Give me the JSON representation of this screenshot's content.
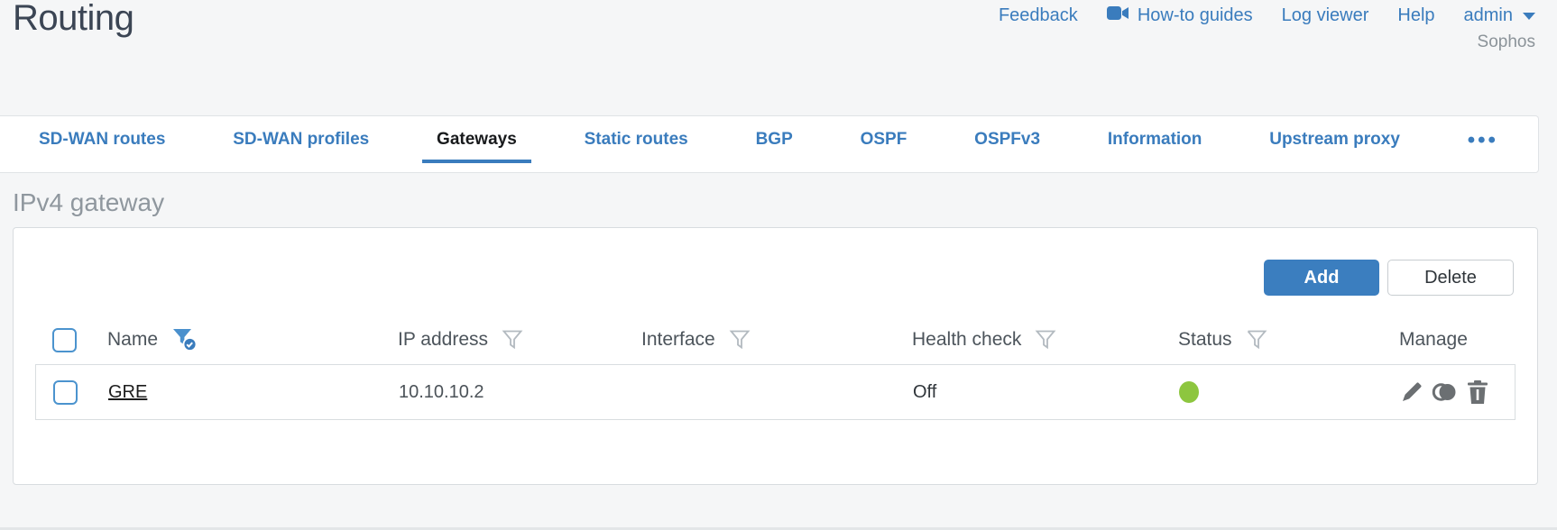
{
  "page": {
    "title": "Routing",
    "brand": "Sophos"
  },
  "topnav": {
    "feedback": "Feedback",
    "howto_guides": "How-to guides",
    "log_viewer": "Log viewer",
    "help": "Help",
    "user": "admin"
  },
  "tabs": {
    "items": [
      {
        "label": "SD-WAN routes",
        "active": false
      },
      {
        "label": "SD-WAN profiles",
        "active": false
      },
      {
        "label": "Gateways",
        "active": true
      },
      {
        "label": "Static routes",
        "active": false
      },
      {
        "label": "BGP",
        "active": false
      },
      {
        "label": "OSPF",
        "active": false
      },
      {
        "label": "OSPFv3",
        "active": false
      },
      {
        "label": "Information",
        "active": false
      },
      {
        "label": "Upstream proxy",
        "active": false
      }
    ],
    "overflow": "•••"
  },
  "section": {
    "heading": "IPv4 gateway"
  },
  "toolbar": {
    "add": "Add",
    "delete": "Delete"
  },
  "table": {
    "columns": [
      {
        "label": "Name",
        "filter": "active"
      },
      {
        "label": "IP address",
        "filter": "default"
      },
      {
        "label": "Interface",
        "filter": "default"
      },
      {
        "label": "Health check",
        "filter": "default"
      },
      {
        "label": "Status",
        "filter": "default"
      },
      {
        "label": "Manage",
        "filter": "none"
      }
    ],
    "rows": [
      {
        "name": "GRE",
        "ip_address": "10.10.10.2",
        "interface": "",
        "health_check": "Off",
        "status": "up",
        "status_color": "#8dc63f",
        "manage": [
          "edit",
          "clone",
          "delete"
        ]
      }
    ]
  },
  "colors": {
    "accent_blue": "#3a7cbd",
    "button_blue": "#3b7ebf",
    "status_green": "#8dc63f",
    "heading_gray": "#8f979e"
  }
}
